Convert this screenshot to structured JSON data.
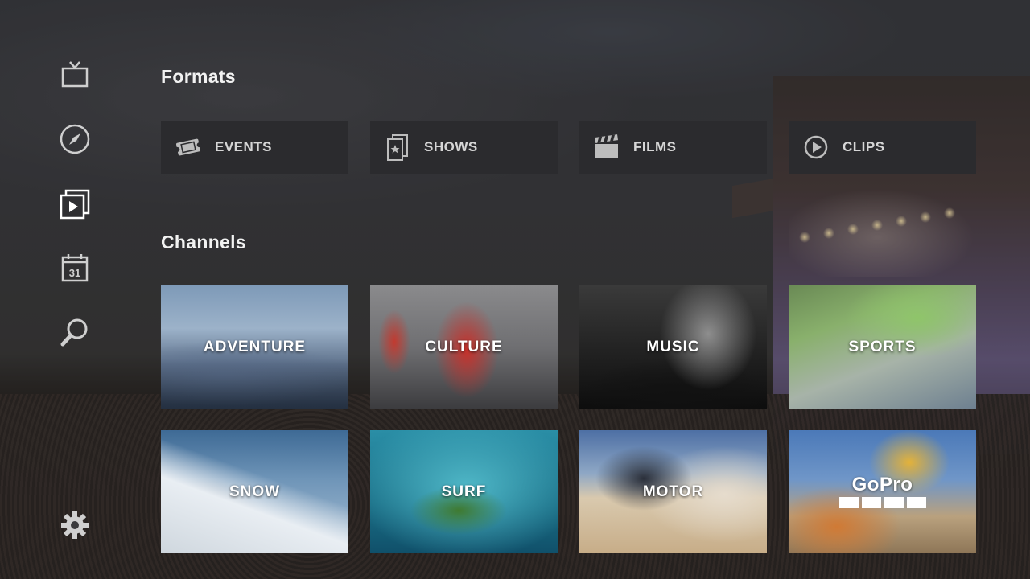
{
  "sidebar": {
    "items": [
      {
        "icon": "tv-icon"
      },
      {
        "icon": "compass-icon"
      },
      {
        "icon": "video-library-icon"
      },
      {
        "icon": "calendar-icon",
        "text": "31"
      },
      {
        "icon": "search-icon"
      }
    ],
    "settings_icon": "gear-icon"
  },
  "formats": {
    "title": "Formats",
    "items": [
      {
        "label": "EVENTS",
        "icon": "ticket-icon"
      },
      {
        "label": "SHOWS",
        "icon": "shows-icon"
      },
      {
        "label": "FILMS",
        "icon": "clapperboard-icon"
      },
      {
        "label": "CLIPS",
        "icon": "play-circle-icon"
      }
    ]
  },
  "channels": {
    "title": "Channels",
    "items": [
      {
        "label": "ADVENTURE"
      },
      {
        "label": "CULTURE"
      },
      {
        "label": "MUSIC"
      },
      {
        "label": "SPORTS"
      },
      {
        "label": "SNOW"
      },
      {
        "label": "SURF"
      },
      {
        "label": "MOTOR"
      },
      {
        "label": "GoPro",
        "logo": true
      }
    ]
  },
  "colors": {
    "tile_bg": "#2b2b2e",
    "text": "#ffffff",
    "format_label": "#d6d6d6"
  }
}
